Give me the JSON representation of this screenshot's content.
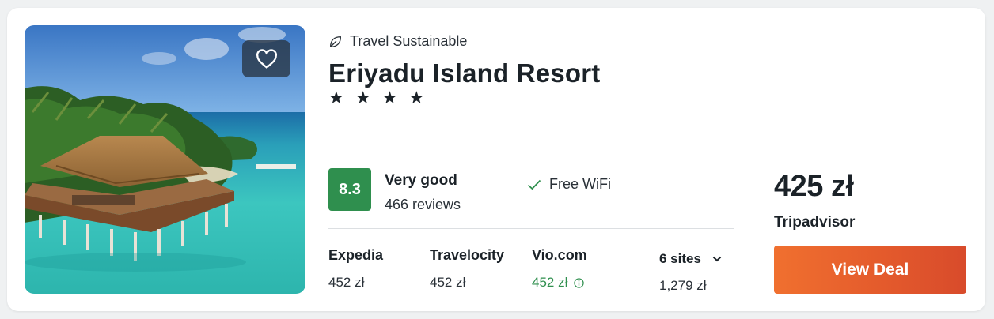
{
  "hotel": {
    "sustainability_label": "Travel Sustainable",
    "name": "Eriyadu Island Resort",
    "stars": "★ ★ ★ ★",
    "star_count": 4
  },
  "rating": {
    "score": "8.3",
    "label": "Very good",
    "reviews": "466 reviews",
    "badge_color": "#2f8f4e"
  },
  "amenities": [
    {
      "label": "Free WiFi",
      "icon": "check-icon"
    }
  ],
  "providers": [
    {
      "name": "Expedia",
      "price": "452 zł"
    },
    {
      "name": "Travelocity",
      "price": "452 zł"
    },
    {
      "name": "Vio.com",
      "price": "452 zł",
      "highlight_color": "#2f8f4e",
      "icon": "info-icon"
    }
  ],
  "more_sites": {
    "label": "6 sites",
    "price": "1,279 zł",
    "icon": "chevron-down-icon"
  },
  "best_deal": {
    "price": "425 zł",
    "site": "Tripadvisor",
    "button_label": "View Deal",
    "button_color": "#e3592c"
  },
  "photo": {
    "favorite_icon": "heart-icon",
    "leaf_icon": "leaf-icon"
  }
}
